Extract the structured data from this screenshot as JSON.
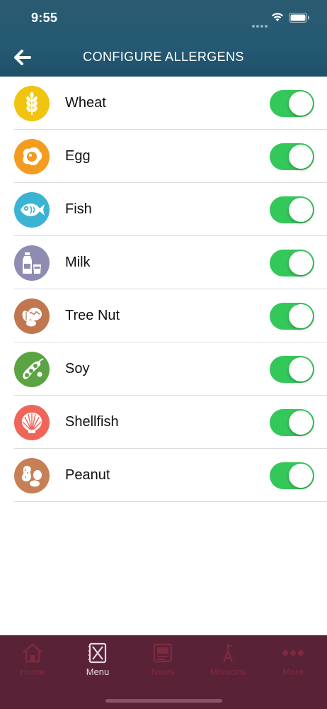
{
  "status": {
    "time": "9:55"
  },
  "header": {
    "title": "CONFIGURE ALLERGENS"
  },
  "allergens": [
    {
      "label": "Wheat",
      "enabled": true,
      "color": "#f1c40f",
      "icon": "wheat-icon"
    },
    {
      "label": "Egg",
      "enabled": true,
      "color": "#f39c1f",
      "icon": "egg-icon"
    },
    {
      "label": "Fish",
      "enabled": true,
      "color": "#3bb3d3",
      "icon": "fish-icon"
    },
    {
      "label": "Milk",
      "enabled": true,
      "color": "#8e8cb0",
      "icon": "milk-icon"
    },
    {
      "label": "Tree Nut",
      "enabled": true,
      "color": "#c0774f",
      "icon": "tree-nut-icon"
    },
    {
      "label": "Soy",
      "enabled": true,
      "color": "#5aa542",
      "icon": "soy-icon"
    },
    {
      "label": "Shellfish",
      "enabled": true,
      "color": "#f0655a",
      "icon": "shellfish-icon"
    },
    {
      "label": "Peanut",
      "enabled": true,
      "color": "#c77f55",
      "icon": "peanut-icon"
    }
  ],
  "tabbar": {
    "items": [
      {
        "label": "Home",
        "icon": "home-icon",
        "active": false
      },
      {
        "label": "Menu",
        "icon": "menu-icon",
        "active": true
      },
      {
        "label": "News",
        "icon": "news-icon",
        "active": false
      },
      {
        "label": "Missions",
        "icon": "missions-icon",
        "active": false
      },
      {
        "label": "More",
        "icon": "more-icon",
        "active": false
      }
    ]
  },
  "colors": {
    "header": "#255a74",
    "toggle_on": "#34c759",
    "tabbar": "#5a2236"
  }
}
